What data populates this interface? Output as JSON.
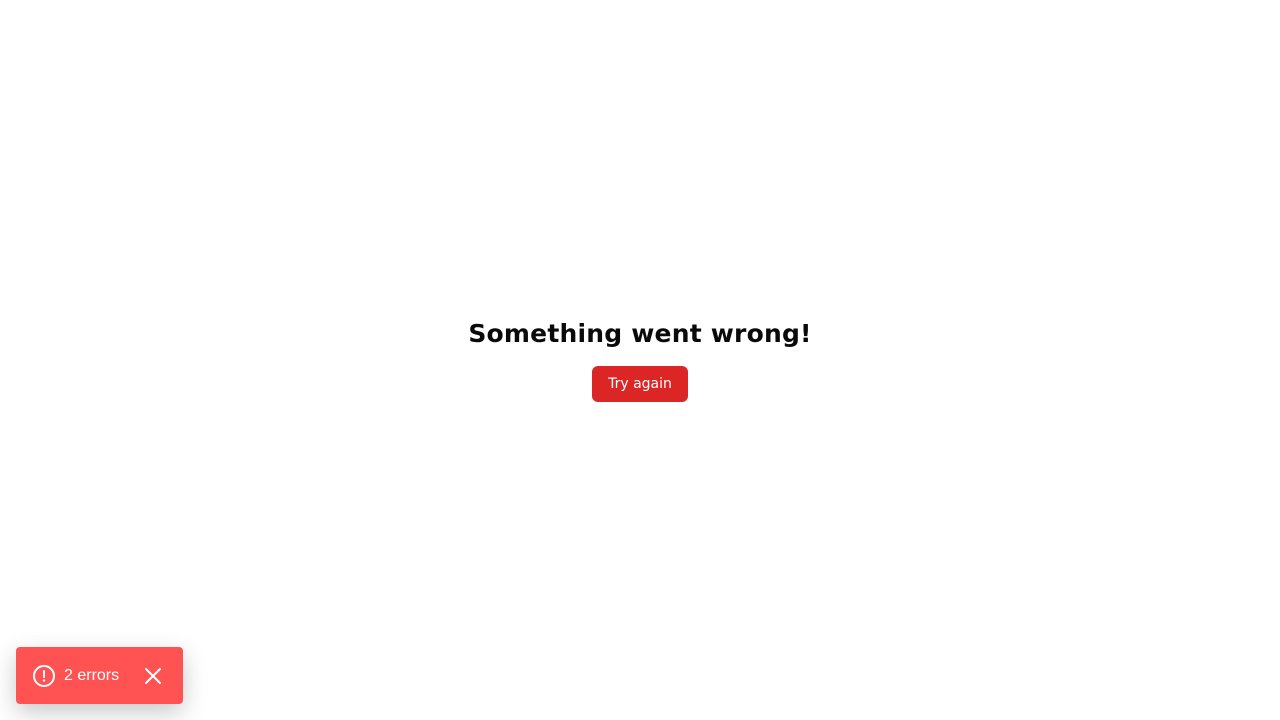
{
  "error": {
    "title": "Something went wrong!",
    "retry_label": "Try again"
  },
  "toast": {
    "label": "2 errors",
    "icon": "alert-circle-icon",
    "close_icon": "close-icon",
    "background_color": "#ff5252"
  },
  "colors": {
    "button": "#dc2626",
    "title": "#0a0a0a"
  }
}
